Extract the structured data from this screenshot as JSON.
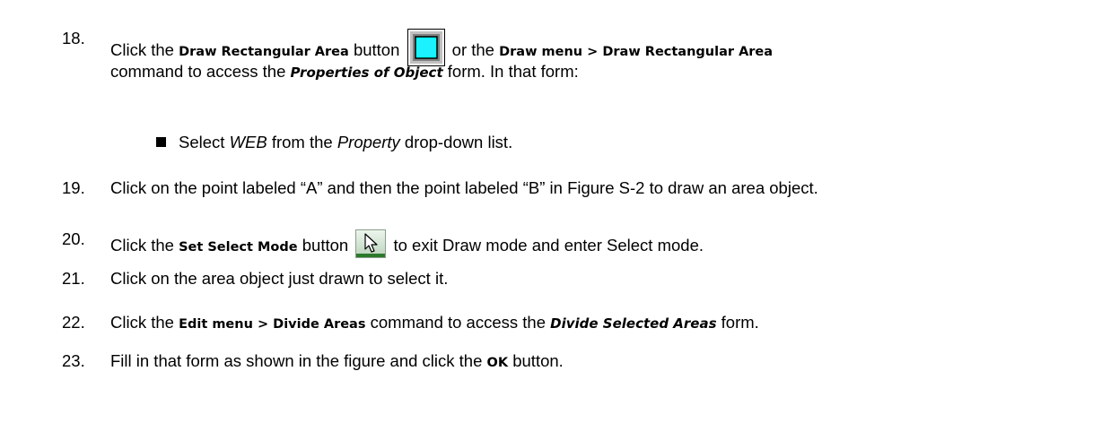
{
  "steps": [
    {
      "number": "18.",
      "parts": [
        "Click the",
        "Draw Rectangular Area",
        "button",
        "or the",
        "Draw menu > Draw Rectangular Area"
      ],
      "line2": [
        "command to access the",
        "Properties of Object",
        "form. In that form:"
      ]
    },
    {
      "bullet": [
        "Select",
        "WEB",
        "from the",
        "Property",
        "drop-down list."
      ]
    },
    {
      "number": "19.",
      "text": "Click on the point labeled “A” and then the point labeled “B” in Figure S-2 to draw an area object."
    },
    {
      "number": "20.",
      "parts": [
        "Click the",
        "Set Select Mode",
        "button",
        "to exit Draw mode and enter Select mode."
      ]
    },
    {
      "number": "21.",
      "text": "Click on the area object just drawn to select it."
    },
    {
      "number": "22.",
      "parts": [
        "Click the",
        "Edit menu > Divide Areas",
        "command to access the",
        "Divide Selected Areas",
        "form."
      ]
    },
    {
      "number": "23.",
      "parts": [
        "Fill in that form as shown in the figure and click the",
        "OK",
        "button."
      ]
    }
  ],
  "icons": {
    "draw_rect": "draw-rectangular-area-icon",
    "select_mode": "set-select-mode-icon"
  },
  "colors": {
    "icon_cyan": "#00ffff",
    "icon_gray": "#c0c0c0"
  }
}
